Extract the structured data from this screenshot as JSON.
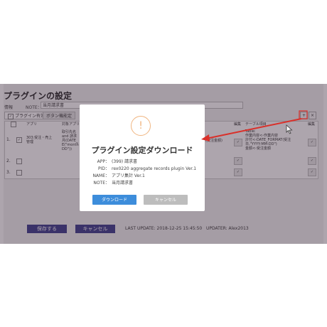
{
  "page": {
    "title": "プラグインの設定",
    "info_label": "情報",
    "note_label": "NOTE：",
    "note_value": "当月請求書"
  },
  "tabs": [
    {
      "label": "プラグイン有効",
      "checked": "✓"
    },
    {
      "label": "ボタン機能定"
    }
  ],
  "table": {
    "headers": [
      "アプリ",
      "対象アプリ",
      "編集",
      "テーブル項目",
      "編集"
    ],
    "rows": [
      {
        "num": "1.",
        "check": "✓",
        "app": "303:受注・売上\n管理",
        "target": "取引先名\nand 請求\n月(DATE_\nE(\"month\nDD\"))",
        "table_field": "Table:\n作業内容<-作業内容\n計付<-DATE_FORMAT(受注\n日,\"YYYY-MM-DD\")\n金額<-受注金額",
        "mid_text": "(受注金額)"
      },
      {
        "num": "2.",
        "check": ""
      },
      {
        "num": "3.",
        "check": ""
      }
    ],
    "edit_icon": "✓",
    "plus": "+",
    "minus": "×"
  },
  "footer": {
    "save_label": "保存する",
    "cancel_label": "キャンセル",
    "last_update": "LAST UPDATE: 2018-12-25 15:45:50",
    "updater": "UPDATER: Alex2013"
  },
  "modal": {
    "icon": "!",
    "title": "プラグイン設定ダウンロード",
    "app_label": "APP：",
    "app_value": "(399) 請求書",
    "pid_label": "PID：",
    "pid_value": "rex0220 aggregate records plugin Ver.1",
    "name_label": "NAME：",
    "name_value": "アプリ集計 Ver.1",
    "note_label": "NOTE：",
    "note_value": "当月請求書",
    "download_label": "ダウンロード",
    "cancel_label": "キャンセル"
  },
  "colors": {
    "accent_blue": "#3d8ddb",
    "alert_orange": "#f0b580",
    "arrow_red": "#d9302a",
    "nav_button": "#3a3a8a"
  },
  "icons": {
    "warning": "exclamation-circle-icon",
    "arrow": "red-arrow-annotation",
    "cursor": "mouse-pointer-icon"
  }
}
